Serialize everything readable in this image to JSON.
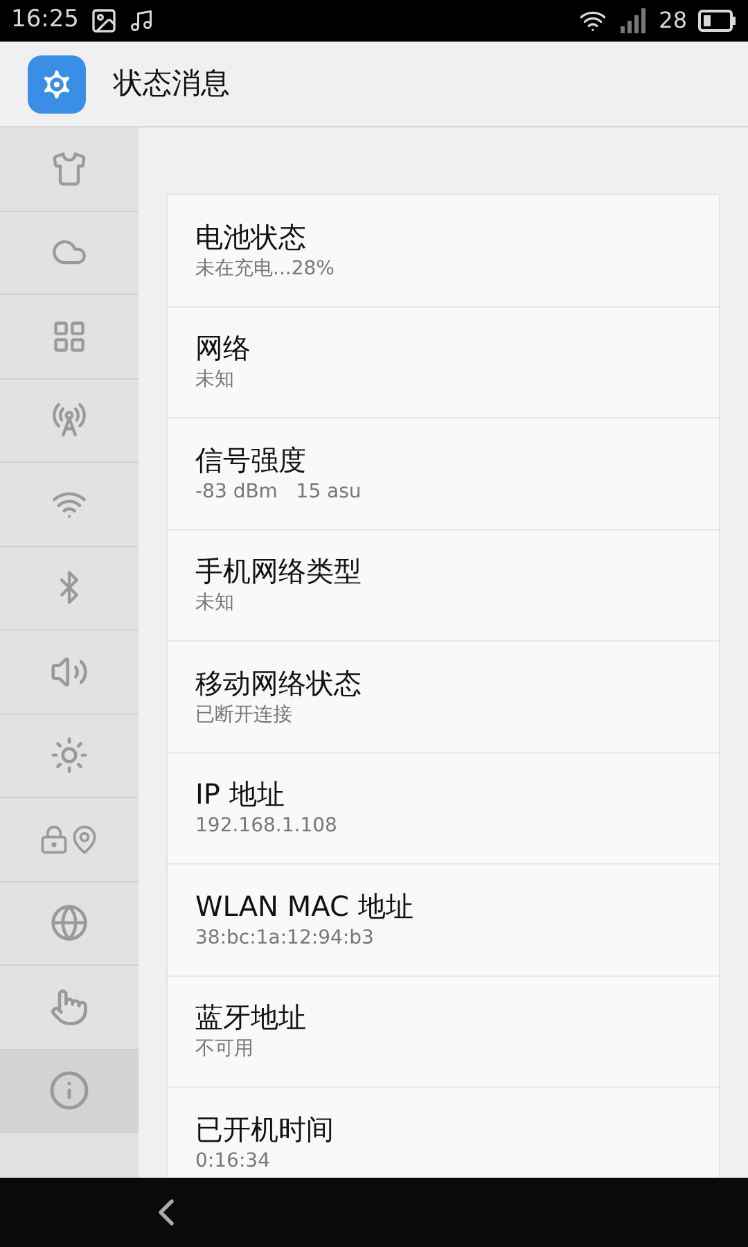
{
  "status_bar": {
    "time": "16:25",
    "battery": "28"
  },
  "header": {
    "title": "状态消息"
  },
  "sidebar": {
    "items": [
      {
        "kind": "theme",
        "selected": false
      },
      {
        "kind": "cloud",
        "selected": false
      },
      {
        "kind": "apps",
        "selected": false
      },
      {
        "kind": "antenna",
        "selected": false
      },
      {
        "kind": "wifi",
        "selected": false
      },
      {
        "kind": "bluetooth",
        "selected": false
      },
      {
        "kind": "sound",
        "selected": false
      },
      {
        "kind": "brightness",
        "selected": false
      },
      {
        "kind": "security",
        "selected": false
      },
      {
        "kind": "language",
        "selected": false
      },
      {
        "kind": "gesture",
        "selected": false
      },
      {
        "kind": "info",
        "selected": true
      }
    ]
  },
  "list": [
    {
      "title": "电池状态",
      "value": "未在充电...28%"
    },
    {
      "title": "网络",
      "value": "未知"
    },
    {
      "title": "信号强度",
      "value": "-83 dBm   15 asu"
    },
    {
      "title": "手机网络类型",
      "value": "未知"
    },
    {
      "title": "移动网络状态",
      "value": "已断开连接"
    },
    {
      "title": "IP 地址",
      "value": "192.168.1.108"
    },
    {
      "title": "WLAN MAC 地址",
      "value": "38:bc:1a:12:94:b3"
    },
    {
      "title": "蓝牙地址",
      "value": "不可用"
    },
    {
      "title": "已开机时间",
      "value": "0:16:34"
    }
  ]
}
